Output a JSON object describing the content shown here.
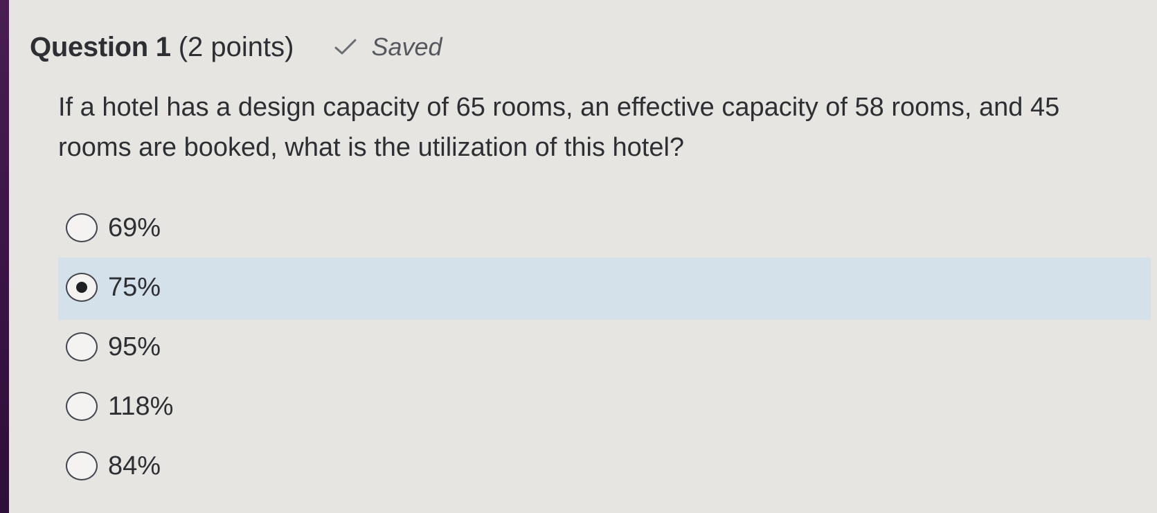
{
  "question": {
    "title": "Question 1",
    "points": "(2 points)",
    "status": "Saved",
    "text": "If a hotel has a design capacity of 65 rooms, an effective capacity of 58 rooms, and 45 rooms are booked, what is the utilization of this hotel?",
    "options": [
      {
        "label": "69%",
        "selected": false
      },
      {
        "label": "75%",
        "selected": true
      },
      {
        "label": "95%",
        "selected": false
      },
      {
        "label": "118%",
        "selected": false
      },
      {
        "label": "84%",
        "selected": false
      }
    ]
  },
  "colors": {
    "background": "#e6e5e2",
    "selected_row": "#d4e0ea",
    "text": "#2d2f33"
  },
  "icons": {
    "status": "checkmark-icon"
  }
}
